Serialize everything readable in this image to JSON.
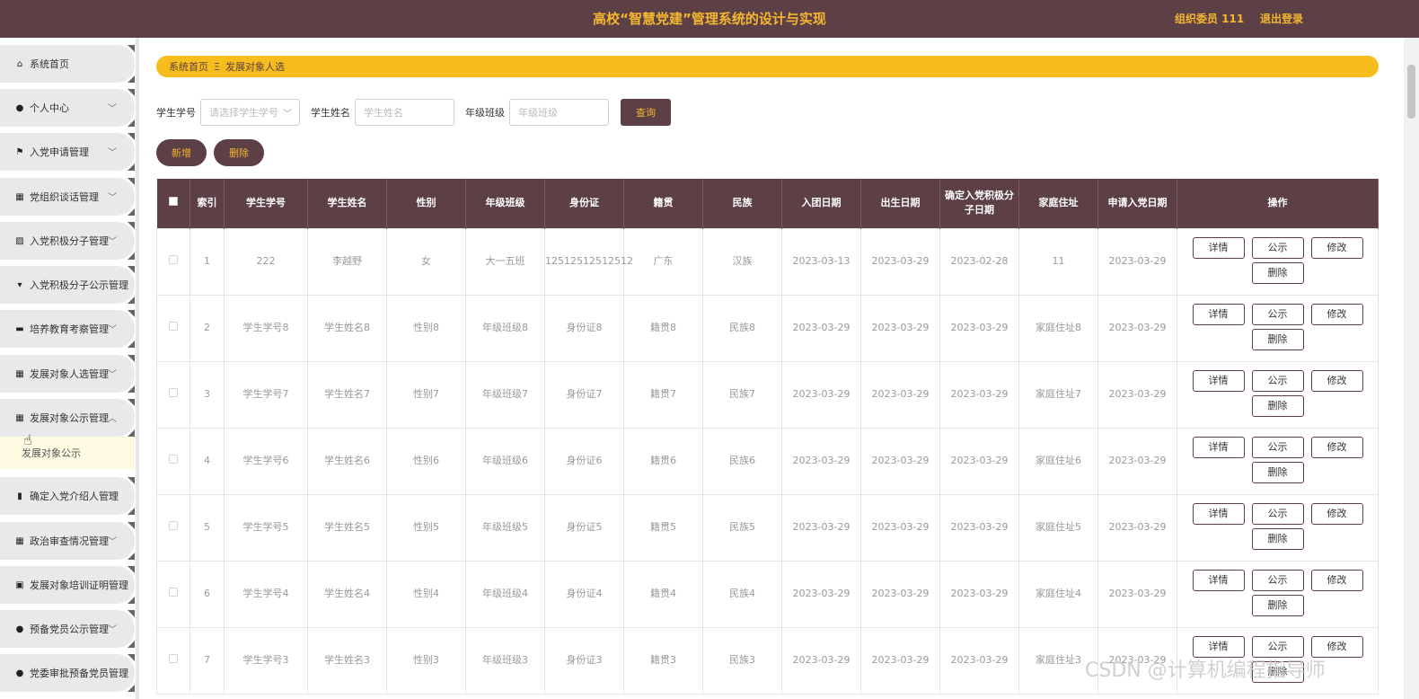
{
  "header": {
    "title": "高校“智慧党建”管理系统的设计与实现",
    "user": "组织委员 111",
    "logout": "退出登录"
  },
  "sidebar": {
    "items": [
      {
        "label": "系统首页",
        "icon": "home-icon",
        "glyph": "⌂",
        "chevron": ""
      },
      {
        "label": "个人中心",
        "icon": "user-icon",
        "glyph": "●",
        "chevron": "﹀"
      },
      {
        "label": "入党申请管理",
        "icon": "flag-icon",
        "glyph": "⚑",
        "chevron": "﹀"
      },
      {
        "label": "党组织谈话管理",
        "icon": "grid-icon",
        "glyph": "▦",
        "chevron": "﹀"
      },
      {
        "label": "入党积极分子管理",
        "icon": "chart-icon",
        "glyph": "▨",
        "chevron": "﹀"
      },
      {
        "label": "入党积极分子公示管理",
        "icon": "pin-icon",
        "glyph": "▾",
        "chevron": ""
      },
      {
        "label": "培养教育考察管理",
        "icon": "briefcase-icon",
        "glyph": "▬",
        "chevron": "﹀"
      },
      {
        "label": "发展对象人选管理",
        "icon": "grid-icon",
        "glyph": "▦",
        "chevron": "﹀"
      },
      {
        "label": "发展对象公示管理",
        "icon": "grid-icon",
        "glyph": "▦",
        "chevron": "︿"
      },
      {
        "label": "确定入党介绍人管理",
        "icon": "bar-chart-icon",
        "glyph": "▮",
        "chevron": "﹀"
      },
      {
        "label": "政治审查情况管理",
        "icon": "grid-icon",
        "glyph": "▦",
        "chevron": "﹀"
      },
      {
        "label": "发展对象培训证明管理",
        "icon": "clipboard-icon",
        "glyph": "▣",
        "chevron": ""
      },
      {
        "label": "预备党员公示管理",
        "icon": "user-icon",
        "glyph": "●",
        "chevron": "﹀"
      },
      {
        "label": "党委审批预备党员管理",
        "icon": "bulb-icon",
        "glyph": "●",
        "chevron": ""
      }
    ],
    "submenu": "发展对象公示"
  },
  "breadcrumb": {
    "home": "系统首页",
    "sep": "Ξ",
    "current": "发展对象人选"
  },
  "search": {
    "label_id": "学生学号",
    "placeholder_id": "请选择学生学号",
    "label_name": "学生姓名",
    "placeholder_name": "学生姓名",
    "label_class": "年级班级",
    "placeholder_class": "年级班级",
    "query": "查询"
  },
  "actions": {
    "add": "新增",
    "delete": "删除"
  },
  "table": {
    "headers": [
      "索引",
      "学生学号",
      "学生姓名",
      "性别",
      "年级班级",
      "身份证",
      "籍贯",
      "民族",
      "入团日期",
      "出生日期",
      "确定入党积极分子日期",
      "家庭住址",
      "申请入党日期",
      "操作"
    ],
    "ops": [
      "详情",
      "公示",
      "修改",
      "删除"
    ],
    "rows": [
      [
        "1",
        "222",
        "李越野",
        "女",
        "大一五班",
        "12512512512512",
        "广东",
        "汉族",
        "2023-03-13",
        "2023-03-29",
        "2023-02-28",
        "11",
        "2023-03-29"
      ],
      [
        "2",
        "学生学号8",
        "学生姓名8",
        "性别8",
        "年级班级8",
        "身份证8",
        "籍贯8",
        "民族8",
        "2023-03-29",
        "2023-03-29",
        "2023-03-29",
        "家庭住址8",
        "2023-03-29"
      ],
      [
        "3",
        "学生学号7",
        "学生姓名7",
        "性别7",
        "年级班级7",
        "身份证7",
        "籍贯7",
        "民族7",
        "2023-03-29",
        "2023-03-29",
        "2023-03-29",
        "家庭住址7",
        "2023-03-29"
      ],
      [
        "4",
        "学生学号6",
        "学生姓名6",
        "性别6",
        "年级班级6",
        "身份证6",
        "籍贯6",
        "民族6",
        "2023-03-29",
        "2023-03-29",
        "2023-03-29",
        "家庭住址6",
        "2023-03-29"
      ],
      [
        "5",
        "学生学号5",
        "学生姓名5",
        "性别5",
        "年级班级5",
        "身份证5",
        "籍贯5",
        "民族5",
        "2023-03-29",
        "2023-03-29",
        "2023-03-29",
        "家庭住址5",
        "2023-03-29"
      ],
      [
        "6",
        "学生学号4",
        "学生姓名4",
        "性别4",
        "年级班级4",
        "身份证4",
        "籍贯4",
        "民族4",
        "2023-03-29",
        "2023-03-29",
        "2023-03-29",
        "家庭住址4",
        "2023-03-29"
      ],
      [
        "7",
        "学生学号3",
        "学生姓名3",
        "性别3",
        "年级班级3",
        "身份证3",
        "籍贯3",
        "民族3",
        "2023-03-29",
        "2023-03-29",
        "2023-03-29",
        "家庭住址3",
        "2023-03-29"
      ]
    ]
  },
  "watermark": "CSDN @计算机编程指导师",
  "colors": {
    "primary": "#5d3f46",
    "accent": "#f6bd1c",
    "accent_text": "#f4b72f"
  }
}
